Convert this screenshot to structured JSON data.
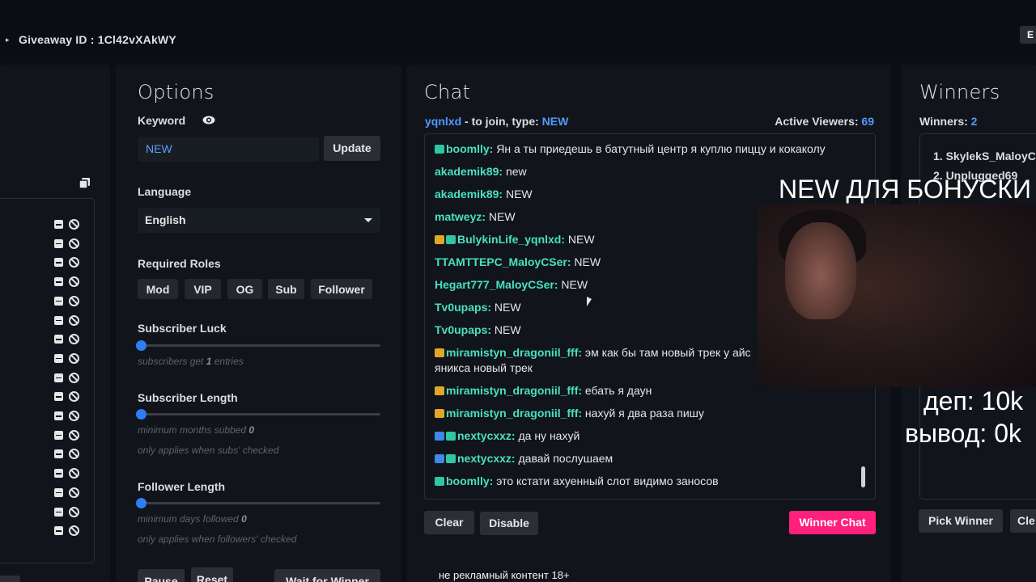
{
  "header": {
    "giveaway_label": "Giveaway ID :",
    "giveaway_id": "1Cl42vXAkWY",
    "corner_btn": "E"
  },
  "left_panel": {
    "rows": 17,
    "bottom_btn": "ort"
  },
  "options": {
    "title": "Options",
    "keyword_label": "Keyword",
    "keyword_value": "NEW",
    "update_btn": "Update",
    "language_label": "Language",
    "language_value": "English",
    "roles_label": "Required Roles",
    "roles": [
      "Mod",
      "VIP",
      "OG",
      "Sub",
      "Follower"
    ],
    "sub_luck_label": "Subscriber Luck",
    "sub_luck_hint_pre": "subscribers get",
    "sub_luck_value": "1",
    "sub_luck_hint_post": "entries",
    "sub_length_label": "Subscriber Length",
    "sub_length_hint": "minimum months subbed",
    "sub_length_value": "0",
    "sub_length_note": "only applies when subs' checked",
    "fol_length_label": "Follower Length",
    "fol_length_hint": "minimum days followed",
    "fol_length_value": "0",
    "fol_length_note": "only applies when followers' checked",
    "bottom_btns": [
      "Pause",
      "Reset",
      "Wait for Winner"
    ]
  },
  "chat": {
    "title": "Chat",
    "channel": "yqnlxd",
    "join_text": " - to join, type: ",
    "join_keyword": "NEW",
    "viewers_label": "Active Viewers:",
    "viewers_count": "69",
    "messages": [
      {
        "badges": [
          "teal"
        ],
        "user": "boomlly",
        "text": "Ян а ты приедешь в батутный центр я куплю пиццу и кокаколу"
      },
      {
        "badges": [],
        "user": "akademik89",
        "text": "new"
      },
      {
        "badges": [],
        "user": "akademik89",
        "text": "NEW"
      },
      {
        "badges": [],
        "user": "matweyz",
        "text": "NEW"
      },
      {
        "badges": [
          "gold",
          "teal"
        ],
        "user": "BulykinLife_yqnlxd",
        "text": "NEW"
      },
      {
        "badges": [],
        "user": "TTAMTTEPC_MaloyCSer",
        "text": "NEW"
      },
      {
        "badges": [],
        "user": "Hegart777_MaloyCSer",
        "text": "NEW"
      },
      {
        "badges": [],
        "user": "Tv0upaps",
        "text": "NEW"
      },
      {
        "badges": [],
        "user": "Tv0upaps",
        "text": "NEW"
      },
      {
        "badges": [
          "gold"
        ],
        "user": "miramistyn_dragoniil_fff",
        "text": "эм как бы там новый трек у айс",
        "text2": "яникса новый трек"
      },
      {
        "badges": [
          "gold"
        ],
        "user": "miramistyn_dragoniil_fff",
        "text": "ебать я даун"
      },
      {
        "badges": [
          "gold"
        ],
        "user": "miramistyn_dragoniil_fff",
        "text": "нахуй я два раза пишу"
      },
      {
        "badges": [
          "blue",
          "teal"
        ],
        "user": "nextycxxz",
        "text": "да ну нахуй"
      },
      {
        "badges": [
          "blue",
          "teal"
        ],
        "user": "nextycxxz",
        "text": "давай послушаем"
      },
      {
        "badges": [
          "teal"
        ],
        "user": "boomlly",
        "text": "это кстати ахуенный слот видимо заносов"
      }
    ],
    "clear_btn": "Clear",
    "disable_btn": "Disable",
    "winner_chat_btn": "Winner Chat",
    "footer_note": "не рекламный контент 18+"
  },
  "winners": {
    "title": "Winners",
    "label": "Winners:",
    "count": "2",
    "list": [
      "1.  SkylekS_MaloyC",
      "2.  Unplugged69"
    ],
    "pick_btn": "Pick Winner",
    "clear_btn": "Cle"
  },
  "overlay": {
    "banner": "NEW ДЛЯ БОНУСКИ",
    "dep": "деп: 10k",
    "withdraw": "вывод: 0k"
  }
}
